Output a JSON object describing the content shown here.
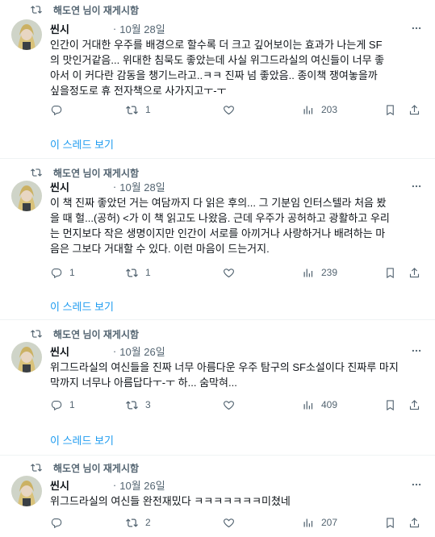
{
  "colors": {
    "accent": "#1d9bf0",
    "muted": "#536471",
    "text": "#0f1419"
  },
  "tweets": [
    {
      "retweeted_by": "해도연 님이 재게시함",
      "author": "씬시",
      "sep": "·",
      "date": "10월 28일",
      "text": "인간이 거대한 우주를 배경으로 할수록 더 크고 깊어보이는 효과가 나는게 SF\n의 맛인거같음... 위대한 침묵도 좋았는데 사실 위그드라실의 여신들이 너무 좋\n아서 이 커다란 감동을 챙기느라고..ㅋㅋ 진짜 넘 좋았음.. 종이책 쟁여놓을까\n싶을정도로 휴 전자책으로 사가지고ㅜ-ㅜ",
      "replies": "",
      "retweets": "1",
      "likes": "",
      "views": "203",
      "show_thread": "이 스레드 보기"
    },
    {
      "retweeted_by": "해도연 님이 재게시함",
      "author": "씬시",
      "sep": "·",
      "date": "10월 28일",
      "text": "이 책 진짜 좋았던 거는 여담까지 다 읽은 후의... 그 기분임 인터스텔라 처음 봤\n을 때 헐...(공허) <가 이 책 읽고도 나왔음. 근데 우주가 공허하고 광활하고 우리\n는 먼지보다 작은 생명이지만 인간이 서로를 아끼거나 사랑하거나 배려하는 마\n음은 그보다 거대할 수 있다. 이런 마음이 드는거지.",
      "replies": "1",
      "retweets": "1",
      "likes": "",
      "views": "239",
      "show_thread": "이 스레드 보기"
    },
    {
      "retweeted_by": "해도연 님이 재게시함",
      "author": "씬시",
      "sep": "·",
      "date": "10월 26일",
      "text": "위그드라실의 여신들을 진짜 너무 아름다운 우주 탐구의 SF소설이다 진짜루 마지\n막까지 너무나 아름답다ㅜ-ㅜ 하... 숨막혀...",
      "replies": "1",
      "retweets": "3",
      "likes": "",
      "views": "409",
      "show_thread": "이 스레드 보기"
    },
    {
      "retweeted_by": "해도연 님이 재게시함",
      "author": "씬시",
      "sep": "·",
      "date": "10월 26일",
      "text": "위그드라실의 여신들 완전재밌다 ㅋㅋㅋㅋㅋㅋㅋ미쳤네",
      "replies": "",
      "retweets": "2",
      "likes": "",
      "views": "207",
      "show_thread": ""
    }
  ]
}
